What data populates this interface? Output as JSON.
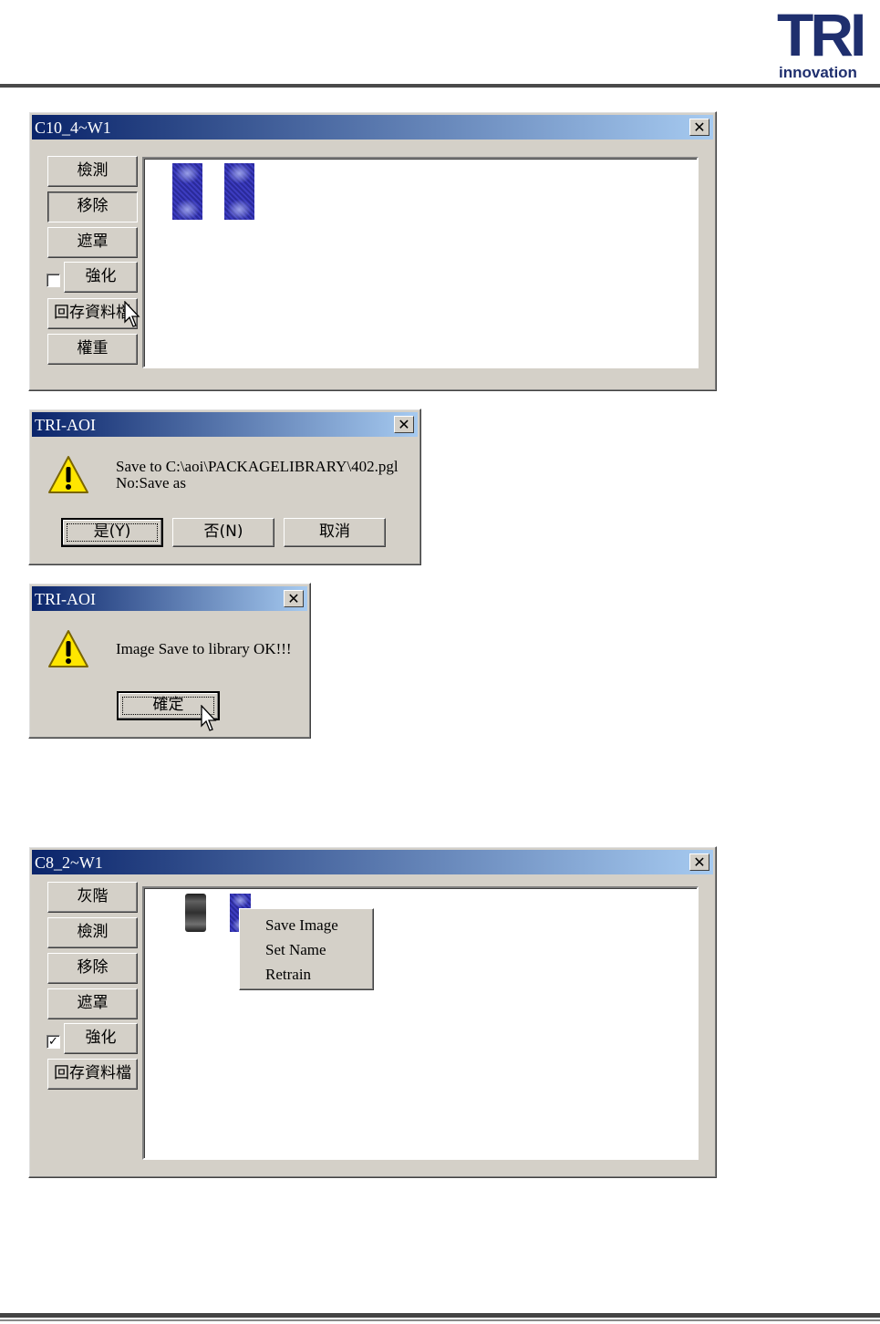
{
  "logo": {
    "brand": "TRI",
    "tagline": "innovation"
  },
  "window1": {
    "title": "C10_4~W1",
    "close": "✕",
    "buttons": {
      "detect": "檢測",
      "remove": "移除",
      "mask": "遮罩",
      "enhance": "強化",
      "save_file": "回存資料檔",
      "weight": "權重"
    },
    "enhance_checked": false
  },
  "dialog1": {
    "title": "TRI-AOI",
    "close": "✕",
    "message_line1": "Save to C:\\aoi\\PACKAGELIBRARY\\402.pgl",
    "message_line2": "No:Save as",
    "yes": "是(Y)",
    "no": "否(N)",
    "cancel": "取消"
  },
  "dialog2": {
    "title": "TRI-AOI",
    "close": "✕",
    "message": "Image Save to library OK!!!",
    "ok": "確定"
  },
  "window2": {
    "title": "C8_2~W1",
    "close": "✕",
    "buttons": {
      "grayscale": "灰階",
      "detect": "檢測",
      "remove": "移除",
      "mask": "遮罩",
      "enhance": "強化",
      "save_file": "回存資料檔"
    },
    "enhance_checked": true,
    "check_mark": "✓",
    "context_menu": [
      "Save Image",
      "Set Name",
      "Retrain"
    ]
  },
  "colors": {
    "title_start": "#0a246a",
    "title_end": "#a6caf0",
    "face": "#d4d0c8",
    "logo": "#1f2f6e"
  }
}
